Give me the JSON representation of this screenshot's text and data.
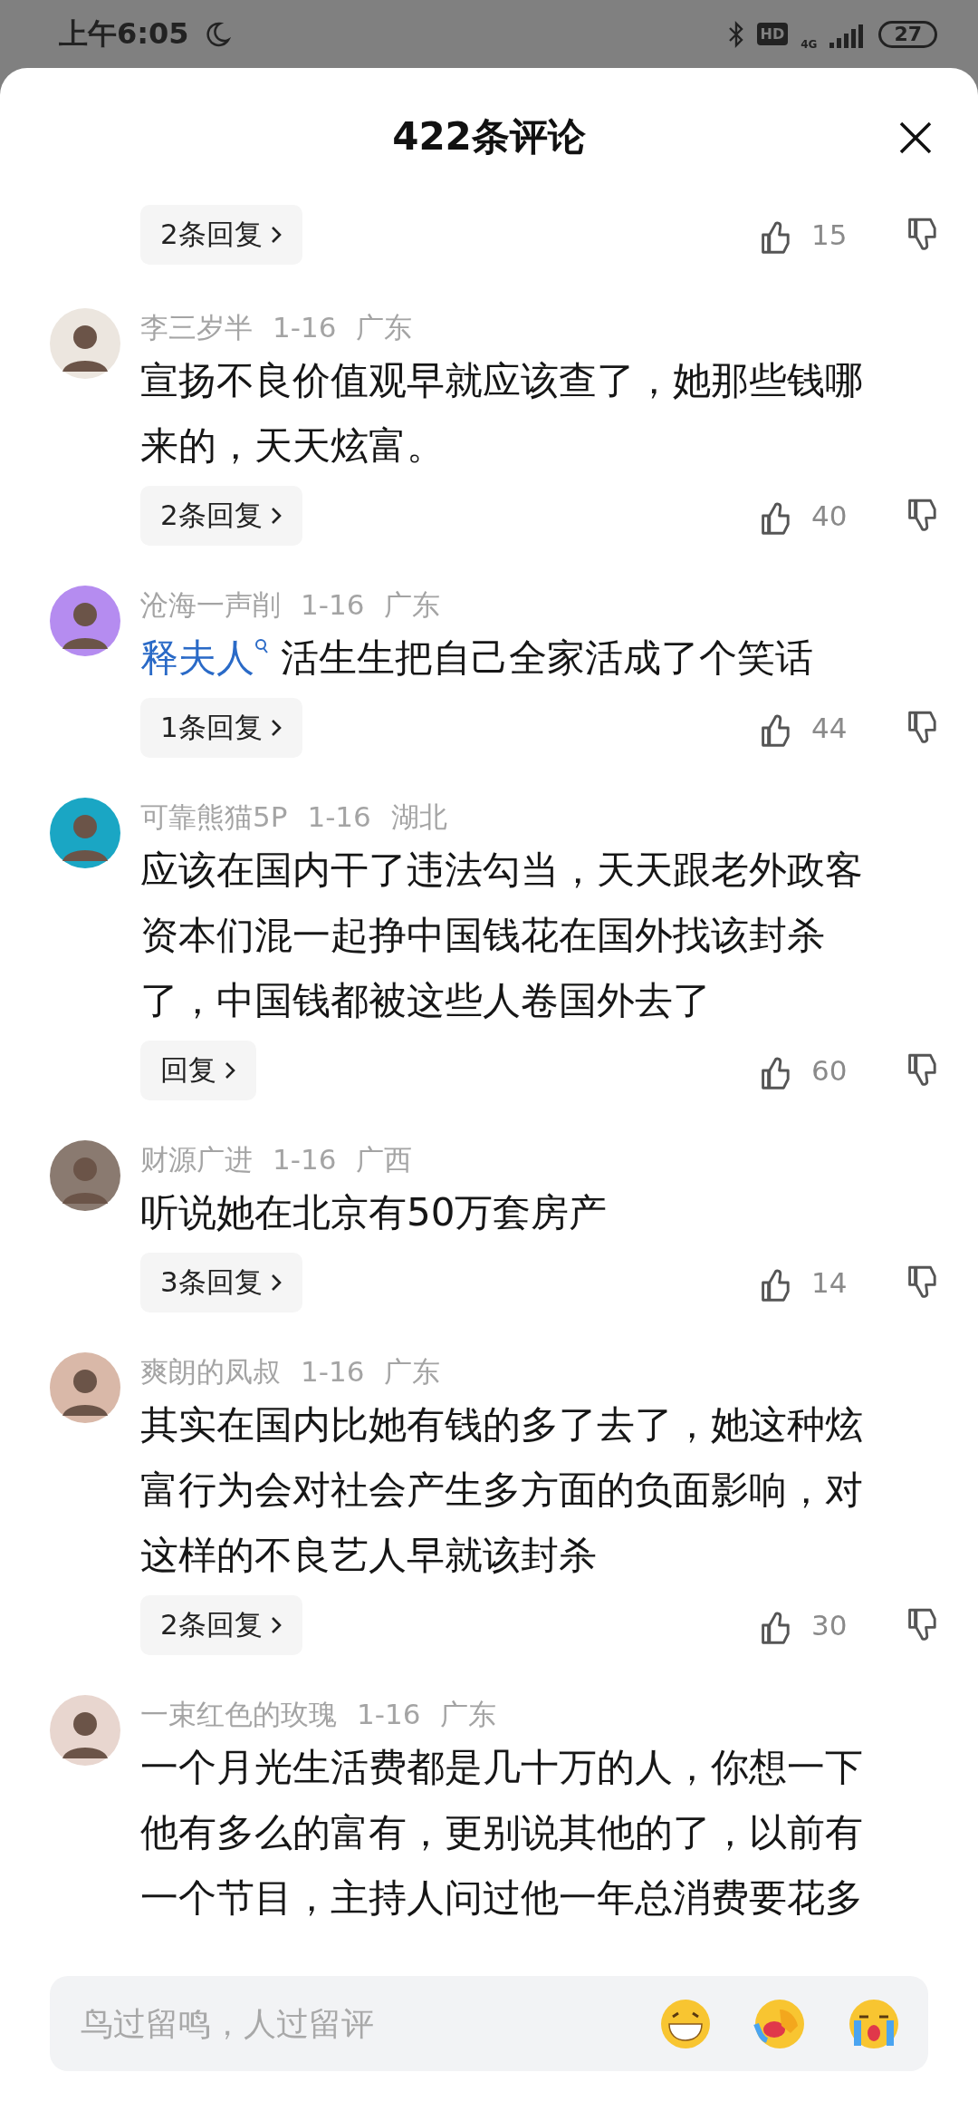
{
  "status_bar": {
    "time": "上午6:05",
    "hd": "HD",
    "network": "4G",
    "battery": "27"
  },
  "sheet": {
    "title": "422条评论"
  },
  "comments": [
    {
      "replies": "2条回复",
      "likes": "15"
    },
    {
      "user": "李三岁半",
      "date": "1-16",
      "region": "广东",
      "text": "宣扬不良价值观早就应该查了，她那些钱哪来的，天天炫富。",
      "replies": "2条回复",
      "likes": "40"
    },
    {
      "user": "沧海一声削",
      "date": "1-16",
      "region": "广东",
      "mention": "释夫人",
      "text": "活生生把自己全家活成了个笑话",
      "replies": "1条回复",
      "likes": "44"
    },
    {
      "user": "可靠熊猫5P",
      "date": "1-16",
      "region": "湖北",
      "text": "应该在国内干了违法勾当，天天跟老外政客资本们混一起挣中国钱花在国外找该封杀了，中国钱都被这些人卷国外去了",
      "replies": "回复",
      "likes": "60"
    },
    {
      "user": "财源广进",
      "date": "1-16",
      "region": "广西",
      "text": "听说她在北京有50万套房产",
      "replies": "3条回复",
      "likes": "14"
    },
    {
      "user": "爽朗的凤叔",
      "date": "1-16",
      "region": "广东",
      "text": "其实在国内比她有钱的多了去了，她这种炫富行为会对社会产生多方面的负面影响，对这样的不良艺人早就该封杀",
      "replies": "2条回复",
      "likes": "30"
    },
    {
      "user": "一束红色的玫瑰",
      "date": "1-16",
      "region": "广东",
      "text": "一个月光生活费都是几十万的人，你想一下他有多么的富有，更别说其他的了，以前有一个节目，主持人问过他一年总消费要花多"
    }
  ],
  "composer": {
    "placeholder": "鸟过留鸣，人过留评"
  }
}
